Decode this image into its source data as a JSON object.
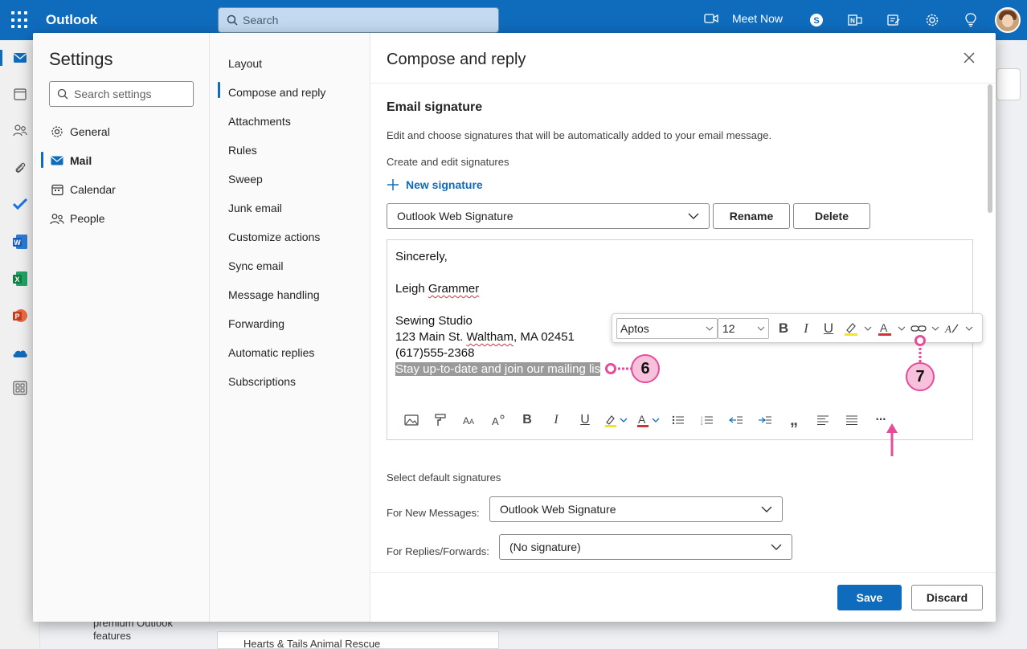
{
  "app": {
    "title": "Outlook",
    "search_placeholder": "Search",
    "meet_now": "Meet Now"
  },
  "background": {
    "premium_text": "premium Outlook features",
    "message_subject": "Hearts & Tails Animal Rescue"
  },
  "settings": {
    "title": "Settings",
    "search_placeholder": "Search settings",
    "categories": [
      {
        "label": "General",
        "icon": "gear-icon"
      },
      {
        "label": "Mail",
        "icon": "mail-icon"
      },
      {
        "label": "Calendar",
        "icon": "calendar-icon"
      },
      {
        "label": "People",
        "icon": "people-icon"
      }
    ],
    "mail_sections": [
      "Layout",
      "Compose and reply",
      "Attachments",
      "Rules",
      "Sweep",
      "Junk email",
      "Customize actions",
      "Sync email",
      "Message handling",
      "Forwarding",
      "Automatic replies",
      "Subscriptions"
    ]
  },
  "pane": {
    "title": "Compose and reply",
    "section_title": "Email signature",
    "description": "Edit and choose signatures that will be automatically added to your email message.",
    "create_edit_label": "Create and edit signatures",
    "new_signature": "New signature",
    "signature_selected": "Outlook Web Signature",
    "rename": "Rename",
    "delete": "Delete",
    "signature_lines": {
      "l1": "Sincerely,",
      "l2_first": "Leigh ",
      "l2_last": "Grammer",
      "l3": "Sewing Studio",
      "l4_a": "123 Main St. ",
      "l4_b": "Waltham",
      "l4_c": ", MA 02451",
      "l5": "(617)555-2368",
      "l6": "Stay up-to-date and join our mailing lis"
    },
    "float_toolbar": {
      "font": "Aptos",
      "size": "12",
      "bold": "B",
      "italic": "I",
      "underline": "U"
    },
    "bottom_toolbar": {
      "bold": "B",
      "italic": "I",
      "underline": "U",
      "quote": "„",
      "more": "···"
    },
    "callouts": {
      "six": "6",
      "seven": "7"
    },
    "select_default_label": "Select default signatures",
    "new_messages_label": "For New Messages:",
    "new_messages_value": "Outlook Web Signature",
    "replies_label": "For Replies/Forwards:",
    "replies_value": "(No signature)",
    "save": "Save",
    "discard": "Discard"
  },
  "colors": {
    "brand": "#0f6cbd",
    "callout_fill": "#f7c1dc",
    "callout_stroke": "#e64c99"
  }
}
